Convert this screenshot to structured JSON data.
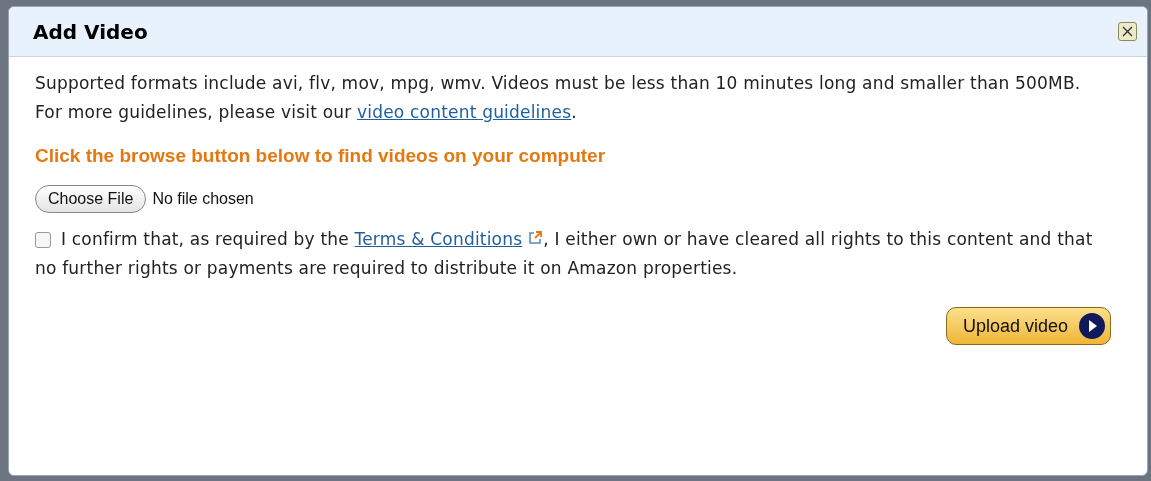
{
  "dialog": {
    "title": "Add Video",
    "intro": {
      "before": "Supported formats include avi, flv, mov, mpg, wmv. Videos must be less than 10 minutes long and smaller than 500MB. For more guidelines, please visit our ",
      "link": "video content guidelines",
      "after": "."
    },
    "instruction": "Click the browse button below to find videos on your computer",
    "file_picker": {
      "button": "Choose File",
      "status": "No file chosen"
    },
    "confirm": {
      "checked": false,
      "before": "I confirm that, as required by the ",
      "link": "Terms & Conditions",
      "after": ", I either own or have cleared all rights to this content and that no further rights or payments are required to distribute it on Amazon properties."
    },
    "upload_button": "Upload video"
  }
}
